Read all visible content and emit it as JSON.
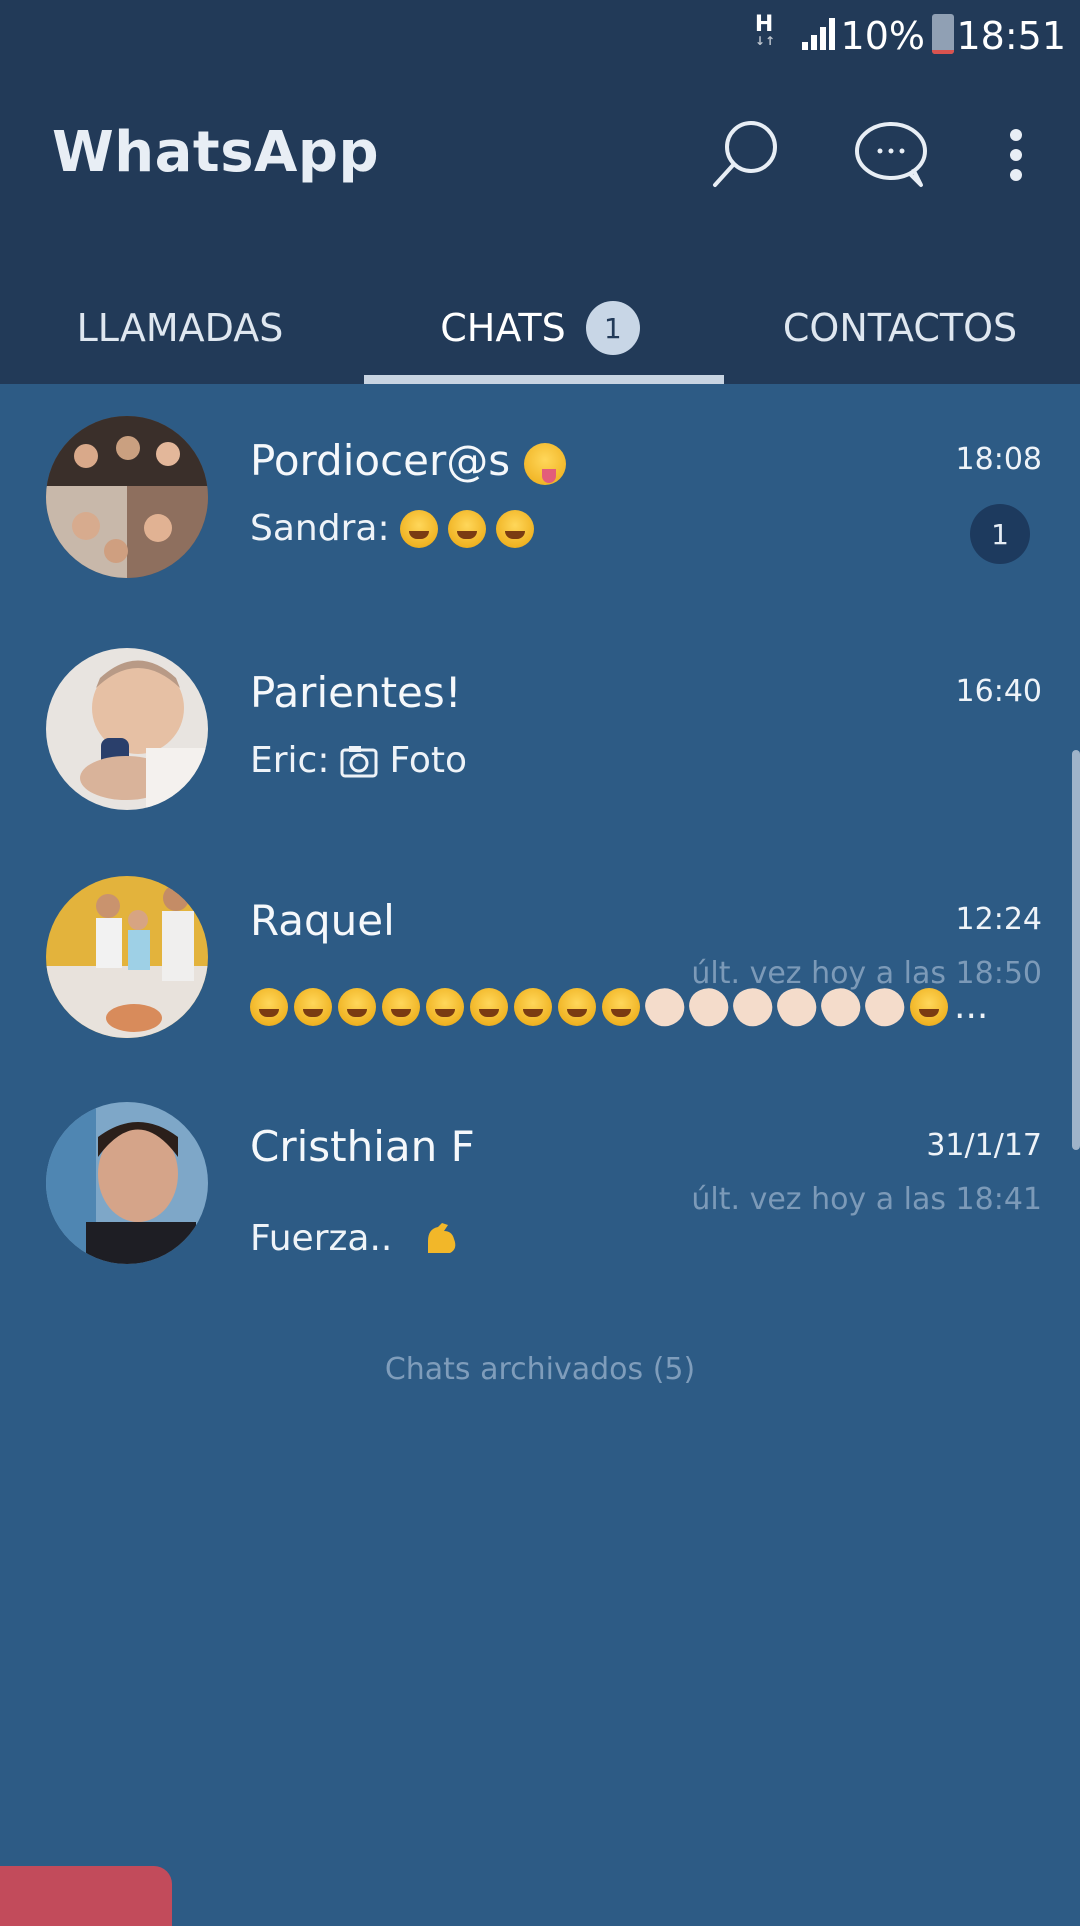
{
  "status_bar": {
    "network": "H",
    "network_sub": "↓↑",
    "battery_percent": "10%",
    "battery_level": 0.1,
    "time": "18:51",
    "icons": [
      "signal-icon",
      "battery-icon"
    ]
  },
  "app_bar": {
    "title": "WhatsApp",
    "icons": [
      "search-icon",
      "new-chat-icon",
      "more-options-icon"
    ]
  },
  "tabs": [
    {
      "label": "LLAMADAS"
    },
    {
      "label": "CHATS",
      "badge": "1",
      "selected": true
    },
    {
      "label": "CONTACTOS"
    }
  ],
  "chats": [
    {
      "name": "Pordiocer@s",
      "time": "18:08",
      "sender": "Sandra:",
      "unread": "1",
      "preview_emoji": [
        "laughing-emoji",
        "laughing-emoji",
        "laughing-emoji"
      ]
    },
    {
      "name": "Parientes!",
      "time": "16:40",
      "sender": "Eric:",
      "preview_text": "Foto",
      "preview_icon": "camera-icon"
    },
    {
      "name": "Raquel",
      "time": "12:24",
      "last_seen": "últ. vez hoy a las 18:50",
      "preview_emoji": [
        "laughing-emoji",
        "laughing-emoji",
        "laughing-emoji",
        "laughing-emoji",
        "laughing-emoji",
        "laughing-emoji",
        "laughing-emoji",
        "laughing-emoji",
        "laughing-emoji",
        "clapping-emoji",
        "clapping-emoji",
        "clapping-emoji",
        "clapping-emoji",
        "clapping-emoji",
        "clapping-emoji",
        "laughing-emoji"
      ],
      "preview_ellipsis": "..."
    },
    {
      "name": "Cristhian F",
      "time": "31/1/17",
      "last_seen": "últ. vez hoy a las 18:41",
      "preview_text": "Fuerza..",
      "preview_emoji": [
        "flexed-biceps-emoji"
      ]
    }
  ],
  "archived": {
    "label": "Chats archivados (5)"
  },
  "colors": {
    "background": "#2d5b85",
    "app_bar": "#223a58",
    "tab_indicator": "#c8d4e2",
    "unread_badge": "#1d3a5e",
    "last_seen_text": "#7c9ab8"
  }
}
